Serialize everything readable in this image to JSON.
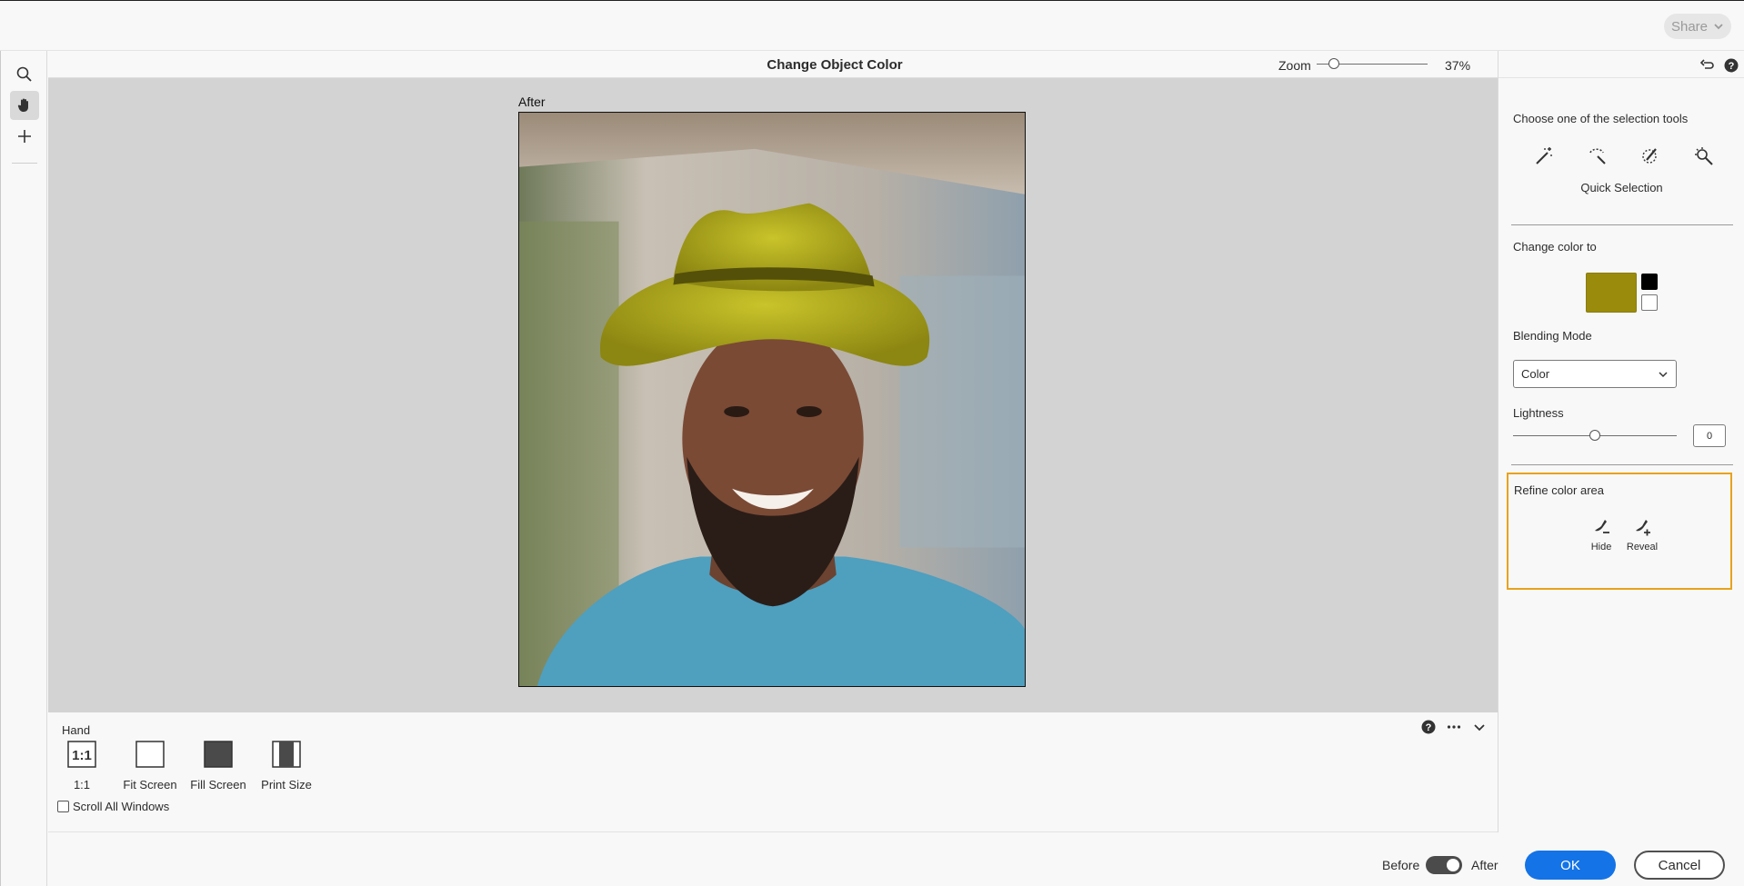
{
  "topbar": {
    "share_label": "Share"
  },
  "left_tools": [
    {
      "icon": "search-icon"
    },
    {
      "icon": "hand-icon",
      "active": true
    },
    {
      "icon": "plus-icon"
    }
  ],
  "header": {
    "title": "Change Object Color",
    "zoom_label": "Zoom",
    "zoom_value": "37%",
    "zoom_level": 0.37
  },
  "canvas": {
    "after_label": "After"
  },
  "options": {
    "tool_title": "Hand",
    "buttons": [
      {
        "label": "1:1",
        "icon": "one-to-one-icon"
      },
      {
        "label": "Fit Screen",
        "icon": "fit-screen-icon"
      },
      {
        "label": "Fill Screen",
        "icon": "fill-screen-icon"
      },
      {
        "label": "Print Size",
        "icon": "print-size-icon"
      }
    ],
    "scroll_all_label": "Scroll All Windows"
  },
  "footer": {
    "before_label": "Before",
    "after_label": "After",
    "ok_label": "OK",
    "cancel_label": "Cancel"
  },
  "panel": {
    "selection_heading": "Choose one of the selection tools",
    "selection_tools": [
      "magic-wand-icon",
      "lasso-icon",
      "quick-selection-icon",
      "refine-selection-icon"
    ],
    "selected_tool": "Quick Selection",
    "change_color_heading": "Change color to",
    "swatch_color": "#9b8b0c",
    "blending_heading": "Blending Mode",
    "blending_value": "Color",
    "lightness_heading": "Lightness",
    "lightness_value": "0",
    "refine_heading": "Refine color area",
    "refine_hide": "Hide",
    "refine_reveal": "Reveal",
    "highlight_color": "#e8a21d"
  }
}
